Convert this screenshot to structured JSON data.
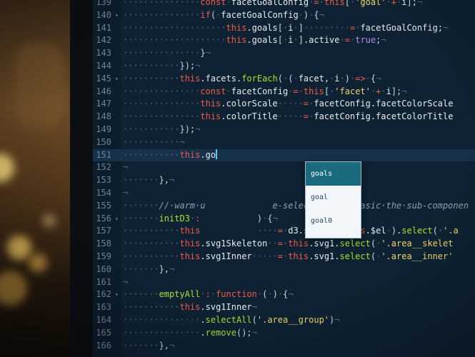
{
  "editor": {
    "lines": [
      {
        "n": "139",
        "fold": "",
        "parts": [
          [
            "d",
            "···············"
          ],
          [
            "k",
            "const"
          ],
          [
            "d",
            "·"
          ],
          [
            "w",
            "facetGoalConfig"
          ],
          [
            "d",
            "·"
          ],
          [
            "k",
            "="
          ],
          [
            "d",
            "·"
          ],
          [
            "k",
            "this"
          ],
          [
            "p",
            "["
          ],
          [
            "d",
            "·"
          ],
          [
            "s",
            "'goal'"
          ],
          [
            "d",
            "·"
          ],
          [
            "k",
            "+"
          ],
          [
            "d",
            "·"
          ],
          [
            "w",
            "i"
          ],
          [
            "p",
            "];"
          ],
          [
            "d",
            "¬"
          ]
        ]
      },
      {
        "n": "140",
        "fold": "▾",
        "parts": [
          [
            "d",
            "···············"
          ],
          [
            "k",
            "if"
          ],
          [
            "p",
            "("
          ],
          [
            "d",
            "·"
          ],
          [
            "w",
            "facetGoalConfig"
          ],
          [
            "d",
            "·"
          ],
          [
            "p",
            ")"
          ],
          [
            "d",
            "·"
          ],
          [
            "p",
            "{"
          ],
          [
            "d",
            "¬"
          ]
        ]
      },
      {
        "n": "141",
        "fold": "",
        "parts": [
          [
            "d",
            "····················"
          ],
          [
            "k",
            "this"
          ],
          [
            "w",
            ".goals"
          ],
          [
            "p",
            "["
          ],
          [
            "d",
            "·"
          ],
          [
            "w",
            "i"
          ],
          [
            "d",
            "·"
          ],
          [
            "p",
            "]"
          ],
          [
            "d",
            "·········"
          ],
          [
            "k",
            "="
          ],
          [
            "d",
            "·"
          ],
          [
            "w",
            "facetGoalConfig;"
          ],
          [
            "d",
            "¬"
          ]
        ]
      },
      {
        "n": "142",
        "fold": "",
        "parts": [
          [
            "d",
            "····················"
          ],
          [
            "k",
            "this"
          ],
          [
            "w",
            ".goals"
          ],
          [
            "p",
            "["
          ],
          [
            "d",
            "·"
          ],
          [
            "w",
            "i"
          ],
          [
            "d",
            "·"
          ],
          [
            "p",
            "]"
          ],
          [
            "w",
            ".active"
          ],
          [
            "d",
            "·"
          ],
          [
            "k",
            "="
          ],
          [
            "d",
            "·"
          ],
          [
            "n",
            "true"
          ],
          [
            "p",
            ";"
          ],
          [
            "d",
            "¬"
          ]
        ]
      },
      {
        "n": "143",
        "fold": "",
        "parts": [
          [
            "d",
            "···············"
          ],
          [
            "p",
            "}"
          ],
          [
            "d",
            "¬"
          ]
        ]
      },
      {
        "n": "144",
        "fold": "",
        "parts": [
          [
            "d",
            "···········"
          ],
          [
            "p",
            "});"
          ],
          [
            "d",
            "¬"
          ]
        ]
      },
      {
        "n": "145",
        "fold": "▾",
        "parts": [
          [
            "d",
            "···········"
          ],
          [
            "k",
            "this"
          ],
          [
            "w",
            ".facets."
          ],
          [
            "f",
            "forEach"
          ],
          [
            "p",
            "("
          ],
          [
            "d",
            "·"
          ],
          [
            "p",
            "("
          ],
          [
            "d",
            "·"
          ],
          [
            "w",
            "facet,"
          ],
          [
            "d",
            "·"
          ],
          [
            "w",
            "i"
          ],
          [
            "d",
            "·"
          ],
          [
            "p",
            ")"
          ],
          [
            "d",
            "·"
          ],
          [
            "k",
            "=>"
          ],
          [
            "d",
            "·"
          ],
          [
            "p",
            "{"
          ],
          [
            "d",
            "¬"
          ]
        ]
      },
      {
        "n": "146",
        "fold": "",
        "parts": [
          [
            "d",
            "···············"
          ],
          [
            "k",
            "const"
          ],
          [
            "d",
            "·"
          ],
          [
            "w",
            "facetConfig"
          ],
          [
            "d",
            "·"
          ],
          [
            "k",
            "="
          ],
          [
            "d",
            "·"
          ],
          [
            "k",
            "this"
          ],
          [
            "p",
            "["
          ],
          [
            "d",
            "·"
          ],
          [
            "s",
            "'facet'"
          ],
          [
            "d",
            "·"
          ],
          [
            "k",
            "+"
          ],
          [
            "d",
            "·"
          ],
          [
            "w",
            "i"
          ],
          [
            "p",
            "];"
          ],
          [
            "d",
            "¬"
          ]
        ]
      },
      {
        "n": "147",
        "fold": "",
        "parts": [
          [
            "d",
            "···············"
          ],
          [
            "k",
            "this"
          ],
          [
            "w",
            ".colorScale"
          ],
          [
            "d",
            "·····"
          ],
          [
            "k",
            "="
          ],
          [
            "d",
            "·"
          ],
          [
            "w",
            "facetConfig.facetColorScale"
          ]
        ]
      },
      {
        "n": "148",
        "fold": "",
        "parts": [
          [
            "d",
            "···············"
          ],
          [
            "k",
            "this"
          ],
          [
            "w",
            ".colorTitle"
          ],
          [
            "d",
            "·····"
          ],
          [
            "k",
            "="
          ],
          [
            "d",
            "·"
          ],
          [
            "w",
            "facetConfig.facetColorTitle"
          ]
        ]
      },
      {
        "n": "149",
        "fold": "",
        "parts": [
          [
            "d",
            "···········"
          ],
          [
            "p",
            "});"
          ],
          [
            "d",
            "¬"
          ]
        ]
      },
      {
        "n": "150",
        "fold": "",
        "parts": [
          [
            "d",
            "···········¬"
          ]
        ]
      },
      {
        "n": "151",
        "fold": "",
        "current": true,
        "parts": [
          [
            "d",
            "···········"
          ],
          [
            "k",
            "this"
          ],
          [
            "w",
            ".go"
          ]
        ]
      },
      {
        "n": "152",
        "fold": "",
        "parts": [
          [
            "d",
            "¬"
          ]
        ]
      },
      {
        "n": "153",
        "fold": "",
        "parts": [
          [
            "d",
            "·······"
          ],
          [
            "p",
            "},"
          ],
          [
            "d",
            "¬"
          ]
        ]
      },
      {
        "n": "154",
        "fold": "",
        "parts": [
          [
            "d",
            "¬"
          ]
        ]
      },
      {
        "n": "155",
        "fold": "",
        "parts": [
          [
            "d",
            "·······"
          ],
          [
            "c",
            "//·warm·u"
          ],
          [
            "d",
            "             "
          ],
          [
            "c",
            "e-selecting·the·basic·the·sub-componen"
          ]
        ]
      },
      {
        "n": "156",
        "fold": "▾",
        "parts": [
          [
            "d",
            "·······"
          ],
          [
            "f",
            "initD3"
          ],
          [
            "d",
            "·"
          ],
          [
            "k",
            ":"
          ],
          [
            "d",
            "           "
          ],
          [
            "p",
            ")"
          ],
          [
            "d",
            "·"
          ],
          [
            "p",
            "{"
          ],
          [
            "d",
            "¬"
          ]
        ]
      },
      {
        "n": "157",
        "fold": "",
        "parts": [
          [
            "d",
            "···········"
          ],
          [
            "k",
            "this"
          ],
          [
            "d",
            "           "
          ],
          [
            "d",
            "····"
          ],
          [
            "k",
            "="
          ],
          [
            "d",
            "·"
          ],
          [
            "w",
            "d3."
          ],
          [
            "f",
            "select"
          ],
          [
            "p",
            "("
          ],
          [
            "d",
            "·"
          ],
          [
            "k",
            "this"
          ],
          [
            "w",
            ".$el"
          ],
          [
            "d",
            "·"
          ],
          [
            "p",
            ")"
          ],
          [
            "w",
            "."
          ],
          [
            "f",
            "select"
          ],
          [
            "p",
            "("
          ],
          [
            "d",
            "·"
          ],
          [
            "s",
            "'.a"
          ]
        ]
      },
      {
        "n": "158",
        "fold": "",
        "parts": [
          [
            "d",
            "···········"
          ],
          [
            "k",
            "this"
          ],
          [
            "w",
            ".svg1Skeleton"
          ],
          [
            "d",
            "··"
          ],
          [
            "k",
            "="
          ],
          [
            "d",
            "·"
          ],
          [
            "k",
            "this"
          ],
          [
            "w",
            ".svg1."
          ],
          [
            "f",
            "select"
          ],
          [
            "p",
            "("
          ],
          [
            "d",
            "·"
          ],
          [
            "s",
            "'.area__skelet"
          ]
        ]
      },
      {
        "n": "159",
        "fold": "",
        "parts": [
          [
            "d",
            "···········"
          ],
          [
            "k",
            "this"
          ],
          [
            "w",
            ".svg1Inner"
          ],
          [
            "d",
            "·····"
          ],
          [
            "k",
            "="
          ],
          [
            "d",
            "·"
          ],
          [
            "k",
            "this"
          ],
          [
            "w",
            ".svg1."
          ],
          [
            "f",
            "select"
          ],
          [
            "p",
            "("
          ],
          [
            "d",
            "·"
          ],
          [
            "s",
            "'.area__inner'"
          ]
        ]
      },
      {
        "n": "160",
        "fold": "",
        "parts": [
          [
            "d",
            "·······"
          ],
          [
            "p",
            "},"
          ],
          [
            "d",
            "¬"
          ]
        ]
      },
      {
        "n": "161",
        "fold": "",
        "parts": [
          [
            "d",
            "¬"
          ]
        ]
      },
      {
        "n": "162",
        "fold": "▾",
        "parts": [
          [
            "d",
            "·······"
          ],
          [
            "f",
            "emptyAll"
          ],
          [
            "d",
            "·"
          ],
          [
            "k",
            ":"
          ],
          [
            "d",
            "·"
          ],
          [
            "k",
            "function"
          ],
          [
            "d",
            "·"
          ],
          [
            "p",
            "("
          ],
          [
            "d",
            "·"
          ],
          [
            "p",
            ")"
          ],
          [
            "d",
            "·"
          ],
          [
            "p",
            "{"
          ],
          [
            "d",
            "¬"
          ]
        ]
      },
      {
        "n": "163",
        "fold": "",
        "parts": [
          [
            "d",
            "···········"
          ],
          [
            "k",
            "this"
          ],
          [
            "w",
            ".svg1Inner"
          ],
          [
            "d",
            "¬"
          ]
        ]
      },
      {
        "n": "164",
        "fold": "",
        "parts": [
          [
            "d",
            "···············"
          ],
          [
            "w",
            "."
          ],
          [
            "f",
            "selectAll"
          ],
          [
            "p",
            "("
          ],
          [
            "s",
            "'.area__group'"
          ],
          [
            "p",
            ")"
          ],
          [
            "d",
            "¬"
          ]
        ]
      },
      {
        "n": "165",
        "fold": "",
        "parts": [
          [
            "d",
            "···············"
          ],
          [
            "w",
            "."
          ],
          [
            "f",
            "remove"
          ],
          [
            "p",
            "();"
          ],
          [
            "d",
            "¬"
          ]
        ]
      },
      {
        "n": "166",
        "fold": "",
        "parts": [
          [
            "d",
            "·······"
          ],
          [
            "p",
            "},"
          ],
          [
            "d",
            "¬"
          ]
        ]
      }
    ]
  },
  "autocomplete": {
    "items": [
      "goals",
      "goal",
      "goal0"
    ],
    "selected_index": 0
  },
  "colors": {
    "keyword": "#f15a4a",
    "function": "#a6e22e",
    "string": "#f2d46a",
    "background": "#0e2233"
  }
}
